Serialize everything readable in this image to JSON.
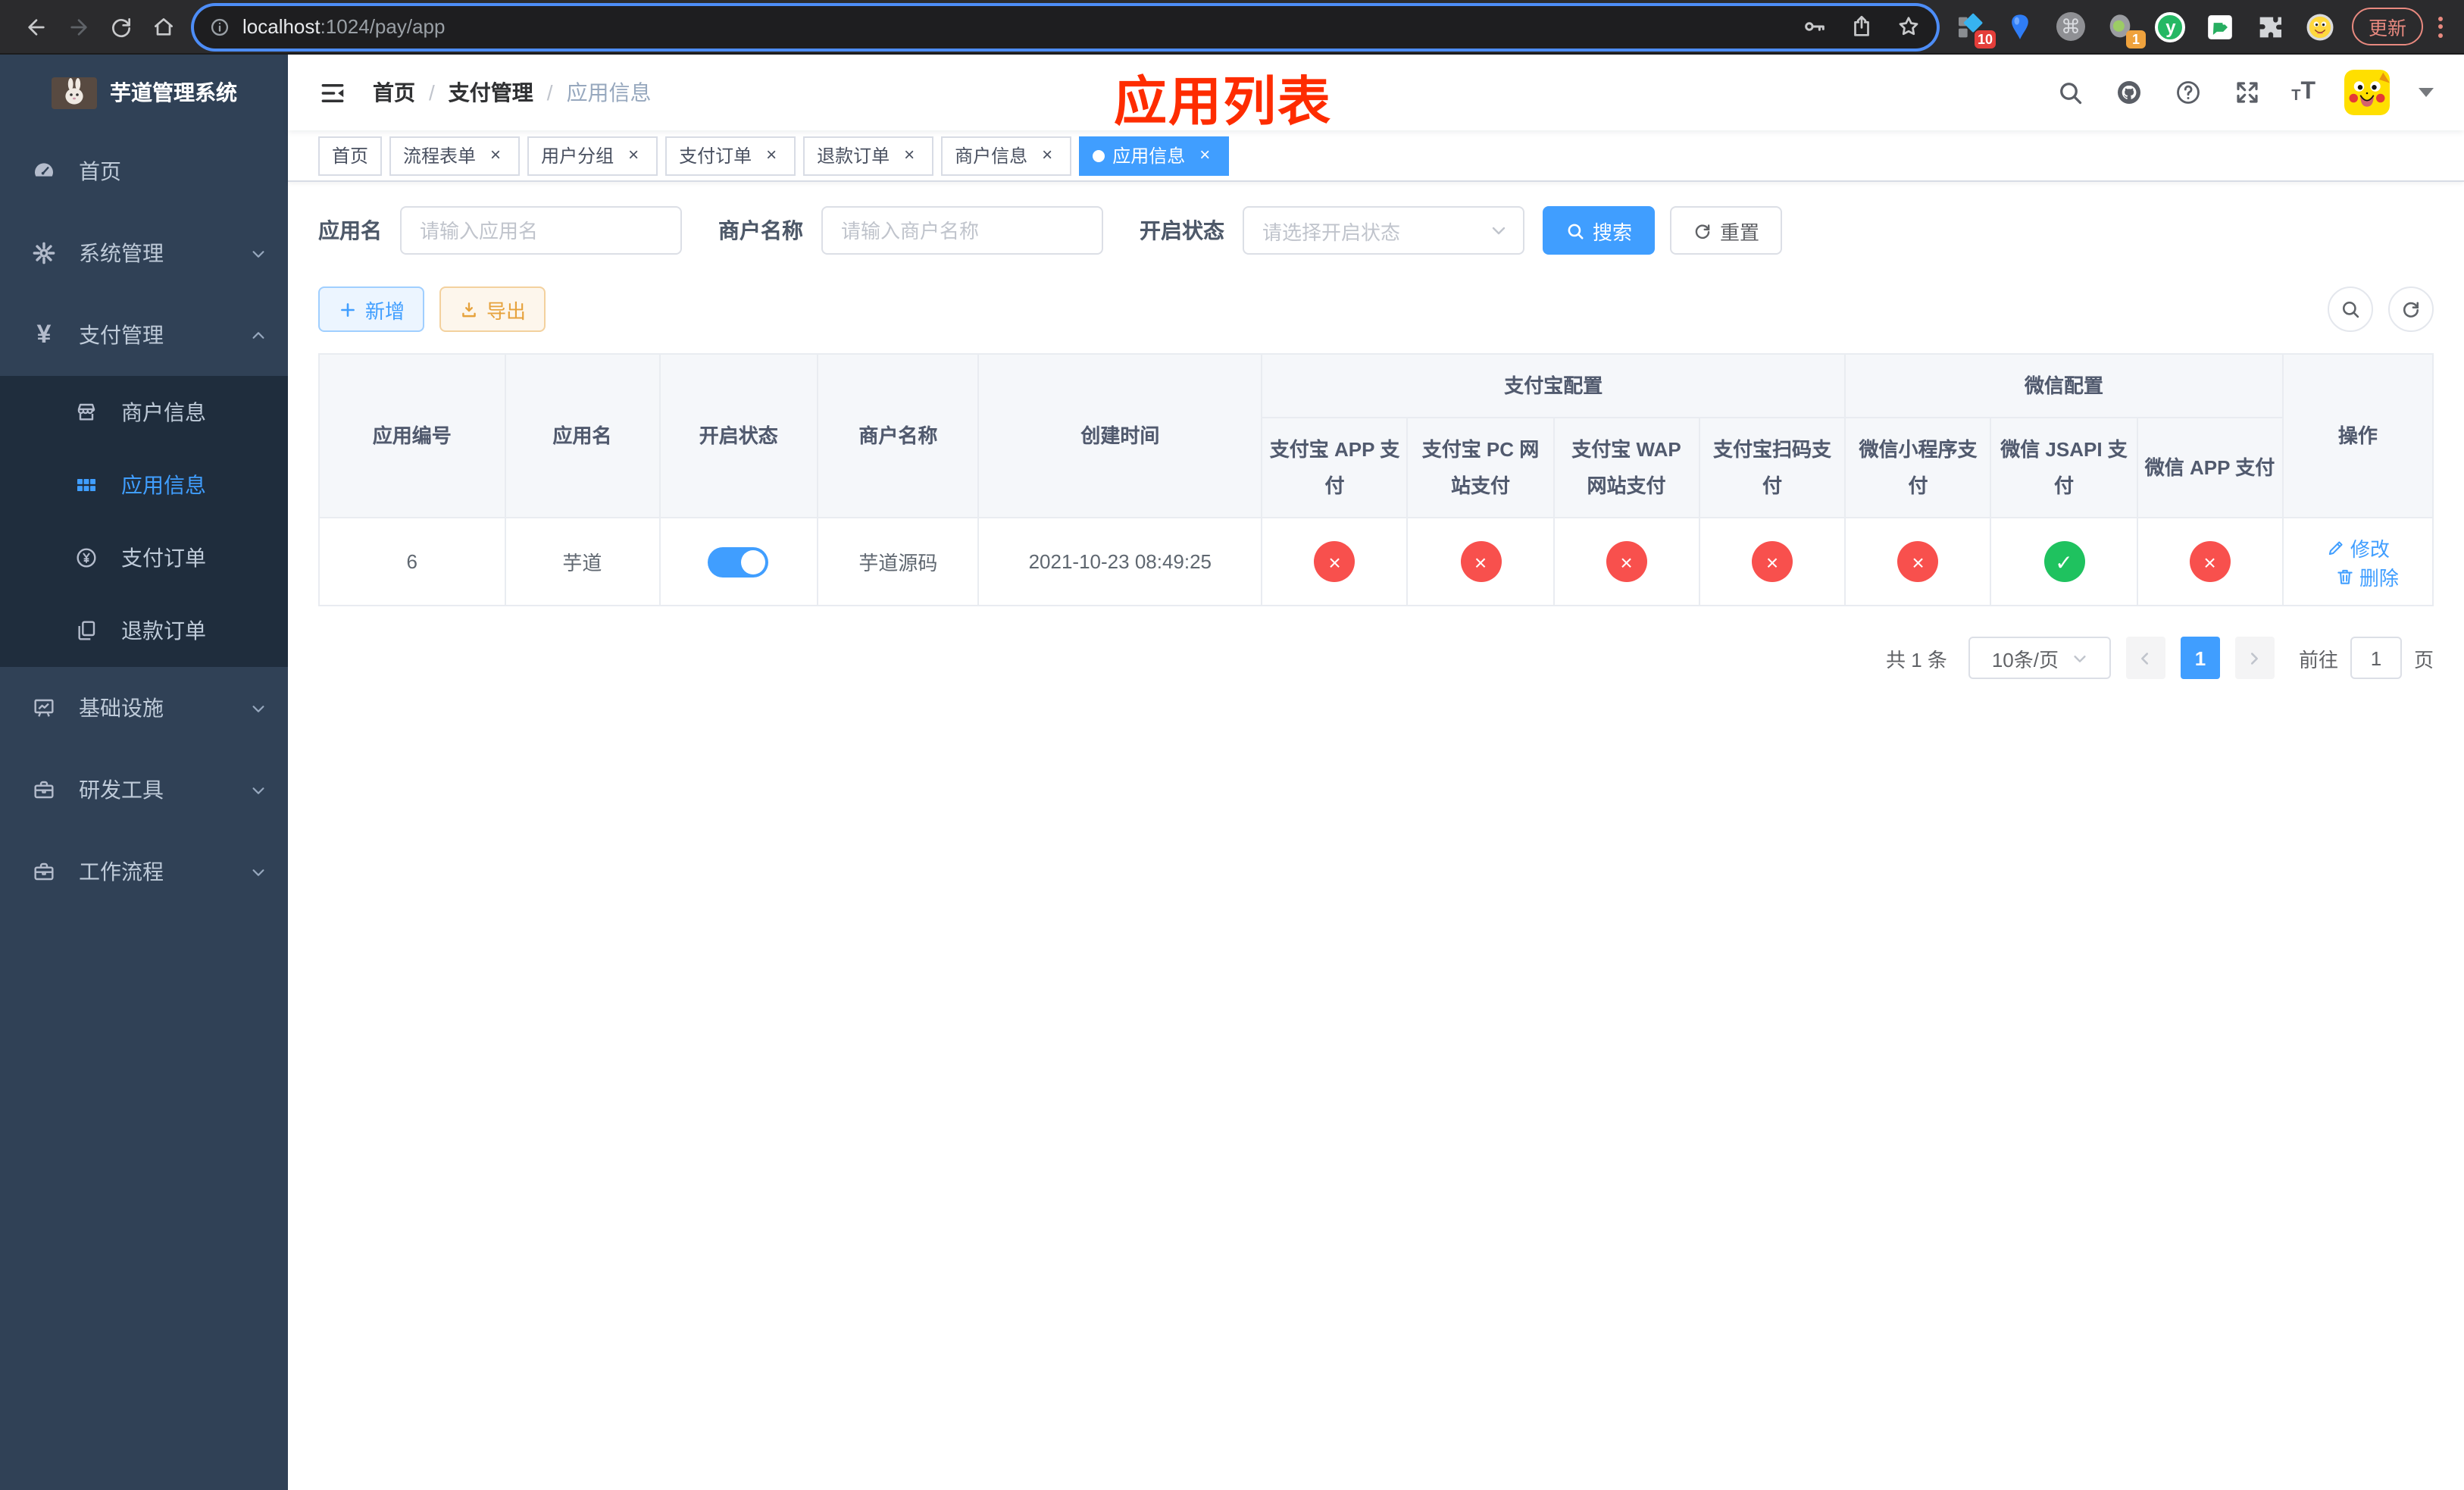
{
  "browser": {
    "url_host": "localhost",
    "url_path": ":1024/pay/app",
    "update_label": "更新",
    "ext_badge_pin": "10",
    "ext_badge_session": "1",
    "ext_monogram": "y"
  },
  "sidebar": {
    "title": "芋道管理系统",
    "items": [
      {
        "label": "首页"
      },
      {
        "label": "系统管理"
      },
      {
        "label": "支付管理",
        "children": [
          {
            "label": "商户信息"
          },
          {
            "label": "应用信息"
          },
          {
            "label": "支付订单"
          },
          {
            "label": "退款订单"
          }
        ]
      },
      {
        "label": "基础设施"
      },
      {
        "label": "研发工具"
      },
      {
        "label": "工作流程"
      }
    ]
  },
  "header": {
    "breadcrumb": [
      "首页",
      "支付管理",
      "应用信息"
    ],
    "separator": "/",
    "annotation": "应用列表"
  },
  "tabs": {
    "items": [
      {
        "label": "首页",
        "active": false,
        "closable": false
      },
      {
        "label": "流程表单",
        "active": false,
        "closable": true
      },
      {
        "label": "用户分组",
        "active": false,
        "closable": true
      },
      {
        "label": "支付订单",
        "active": false,
        "closable": true
      },
      {
        "label": "退款订单",
        "active": false,
        "closable": true
      },
      {
        "label": "商户信息",
        "active": false,
        "closable": true
      },
      {
        "label": "应用信息",
        "active": true,
        "closable": true
      }
    ]
  },
  "filters": {
    "name_label": "应用名",
    "name_placeholder": "请输入应用名",
    "merchant_label": "商户名称",
    "merchant_placeholder": "请输入商户名称",
    "status_label": "开启状态",
    "status_placeholder": "请选择开启状态",
    "search_label": "搜索",
    "reset_label": "重置"
  },
  "toolbar": {
    "add_label": "新增",
    "export_label": "导出"
  },
  "table": {
    "groups": {
      "alipay": "支付宝配置",
      "wechat": "微信配置"
    },
    "columns": {
      "id": "应用编号",
      "name": "应用名",
      "status": "开启状态",
      "merchant": "商户名称",
      "created": "创建时间",
      "actions": "操作"
    },
    "config_columns": [
      "支付宝 APP 支付",
      "支付宝 PC 网站支付",
      "支付宝 WAP 网站支付",
      "支付宝扫码支付",
      "微信小程序支付",
      "微信 JSAPI 支付",
      "微信 APP 支付"
    ],
    "row": {
      "id": "6",
      "name": "芋道",
      "enabled": true,
      "merchant": "芋道源码",
      "created": "2021-10-23 08:49:25",
      "configs": [
        false,
        false,
        false,
        false,
        false,
        true,
        false
      ],
      "edit_label": "修改",
      "delete_label": "删除"
    }
  },
  "pagination": {
    "total_label": "共 1 条",
    "page_size_label": "10条/页",
    "current_page": "1",
    "goto_label": "前往",
    "goto_value": "1",
    "page_unit_label": "页"
  },
  "colors": {
    "accent": "#409eff",
    "danger": "#f8504d",
    "success": "#1fc25f",
    "warning": "#e6a23c",
    "sidebar_bg": "#304156",
    "sidebar_sub_bg": "#1f2d3d",
    "annotation": "#fe2c00"
  }
}
